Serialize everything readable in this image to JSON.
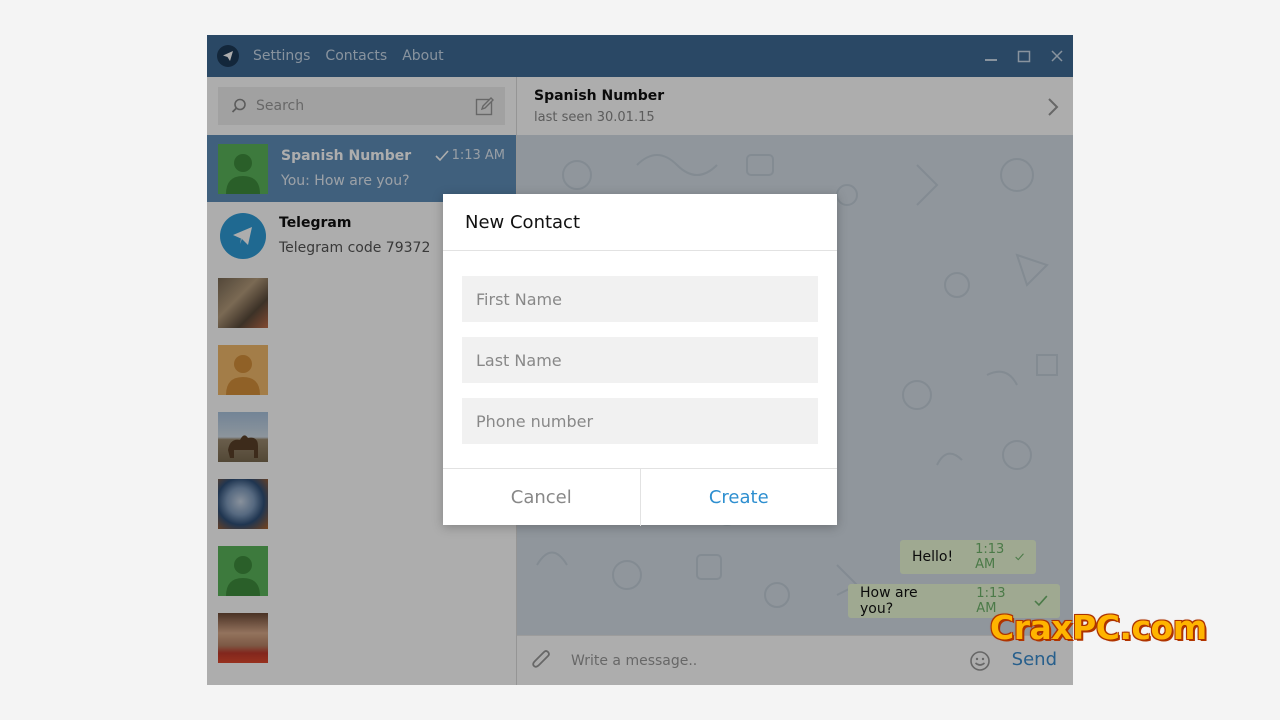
{
  "titlebar": {
    "menu": [
      "Settings",
      "Contacts",
      "About"
    ]
  },
  "search": {
    "placeholder": "Search"
  },
  "chats": [
    {
      "name": "Spanish Number",
      "message": "You: How are you?",
      "time": "1:13 AM",
      "active": true
    },
    {
      "name": "Telegram",
      "message": "Telegram code 79372"
    }
  ],
  "conversation": {
    "peer_name": "Spanish Number",
    "peer_status": "last seen 30.01.15",
    "messages": [
      {
        "text": "Hello!",
        "time": "1:13 AM"
      },
      {
        "text": "How are you?",
        "time": "1:13 AM"
      }
    ],
    "composer_placeholder": "Write a message..",
    "send_label": "Send"
  },
  "dialog": {
    "title": "New Contact",
    "first_name_placeholder": "First Name",
    "last_name_placeholder": "Last Name",
    "phone_placeholder": "Phone number",
    "cancel_label": "Cancel",
    "create_label": "Create"
  },
  "watermark": "CraxPC.com",
  "colors": {
    "titlebar": "#3f6a95",
    "active_chat": "#5f8eb8",
    "accent": "#2e8fd0",
    "bubble": "#eafad6"
  }
}
